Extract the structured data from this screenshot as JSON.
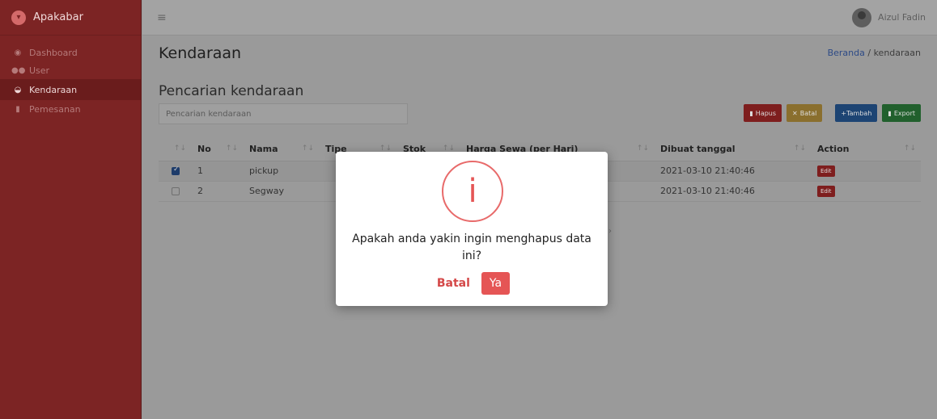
{
  "brand": {
    "name": "Apakabar",
    "logo_icon": "apakabar-logo-icon"
  },
  "sidebar": {
    "items": [
      {
        "label": "Dashboard",
        "icon": "palette-icon"
      },
      {
        "label": "User",
        "icon": "users-icon"
      },
      {
        "label": "Kendaraan",
        "icon": "car-icon",
        "active": true
      },
      {
        "label": "Pemesanan",
        "icon": "clipboard-icon"
      }
    ]
  },
  "topbar": {
    "user_name": "Aizul Fadin",
    "menu_icon": "hamburger-icon"
  },
  "page": {
    "title": "Kendaraan",
    "breadcrumb": {
      "home": "Beranda",
      "separator": "/",
      "current": "kendaraan"
    },
    "section_title": "Pencarian kendaraan",
    "search_placeholder": "Pencarian kendaraan"
  },
  "toolbar": {
    "hapus_label": "Hapus",
    "batal_label": "Batal",
    "tambah_label": "+Tambah",
    "export_label": "Export"
  },
  "table": {
    "columns": [
      "No",
      "Nama",
      "Tipe",
      "Stok",
      "Harga Sewa (per Hari)",
      "Dibuat tanggal",
      "Action"
    ],
    "rows": [
      {
        "checked": true,
        "no": "1",
        "nama": "pickup",
        "dibuat": "2021-03-10 21:40:46",
        "action": "Edit"
      },
      {
        "checked": false,
        "no": "2",
        "nama": "Segway",
        "dibuat": "2021-03-10 21:40:46",
        "action": "Edit"
      }
    ]
  },
  "modal": {
    "icon": "info-icon",
    "message": "Apakah anda yakin ingin menghapus data ini?",
    "cancel_label": "Batal",
    "confirm_label": "Ya"
  },
  "colors": {
    "accent": "#e55555",
    "sidebar": "#7c2424"
  }
}
